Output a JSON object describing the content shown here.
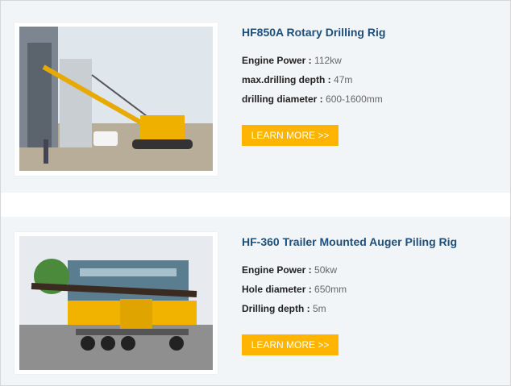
{
  "products": [
    {
      "title": "HF850A Rotary Drilling Rig",
      "specs": [
        {
          "label": "Engine Power :",
          "value": "112kw"
        },
        {
          "label": "max.drilling depth :",
          "value": "47m"
        },
        {
          "label": "drilling diameter :",
          "value": "600-1600mm"
        }
      ],
      "button": "LEARN MORE >>"
    },
    {
      "title": "HF-360 Trailer Mounted Auger Piling Rig",
      "specs": [
        {
          "label": "Engine Power :",
          "value": "50kw"
        },
        {
          "label": "Hole diameter :",
          "value": "650mm"
        },
        {
          "label": "Drilling depth :",
          "value": "5m"
        }
      ],
      "button": "LEARN MORE >>"
    }
  ],
  "colors": {
    "accent": "#ffb400",
    "title": "#1e4f7a",
    "card_bg": "#f2f5f8"
  }
}
